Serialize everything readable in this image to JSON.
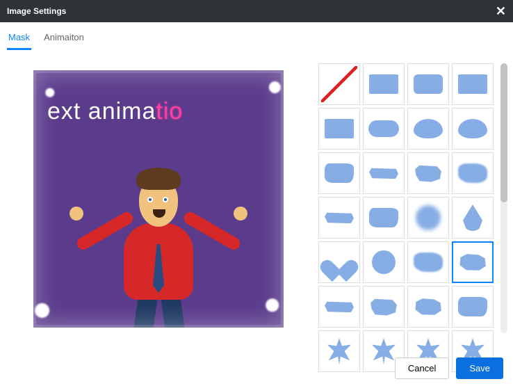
{
  "dialog": {
    "title": "Image Settings"
  },
  "tabs": {
    "mask": "Mask",
    "animation": "Animaiton",
    "active": "mask"
  },
  "preview": {
    "text_plain": "ext anima",
    "text_accent": "tio"
  },
  "masks": [
    {
      "id": "none",
      "shape": "sw-none"
    },
    {
      "id": "rect",
      "shape": "sw-rect"
    },
    {
      "id": "roundrect",
      "shape": "sw-roundrect"
    },
    {
      "id": "rect2",
      "shape": "sw-rect"
    },
    {
      "id": "rect3",
      "shape": "sw-rect"
    },
    {
      "id": "pill",
      "shape": "sw-pill"
    },
    {
      "id": "cloud1",
      "shape": "sw-cloud"
    },
    {
      "id": "cloud2",
      "shape": "sw-cloud"
    },
    {
      "id": "brush-a",
      "shape": "sw-brush1"
    },
    {
      "id": "brush-b",
      "shape": "sw-stroke"
    },
    {
      "id": "brush-c",
      "shape": "sw-brush2"
    },
    {
      "id": "brush-d",
      "shape": "sw-brush3"
    },
    {
      "id": "brush-e",
      "shape": "sw-stroke"
    },
    {
      "id": "brush-f",
      "shape": "sw-brush1"
    },
    {
      "id": "blur-circle",
      "shape": "sw-blurcircle"
    },
    {
      "id": "drop",
      "shape": "sw-drop"
    },
    {
      "id": "heart",
      "shape": "sw-heart"
    },
    {
      "id": "circle",
      "shape": "sw-circle"
    },
    {
      "id": "brush-g",
      "shape": "sw-brush3"
    },
    {
      "id": "brush-sel",
      "shape": "sw-brush4",
      "selected": true
    },
    {
      "id": "stroke-a",
      "shape": "sw-stroke"
    },
    {
      "id": "splat-a",
      "shape": "sw-brush2"
    },
    {
      "id": "splat-b",
      "shape": "sw-brush4"
    },
    {
      "id": "brush-h",
      "shape": "sw-brush1"
    },
    {
      "id": "splat-c",
      "shape": "sw-splat"
    },
    {
      "id": "splat-d",
      "shape": "sw-splat"
    },
    {
      "id": "splat-e",
      "shape": "sw-splat"
    },
    {
      "id": "splat-f",
      "shape": "sw-splat"
    }
  ],
  "buttons": {
    "cancel": "Cancel",
    "save": "Save"
  }
}
